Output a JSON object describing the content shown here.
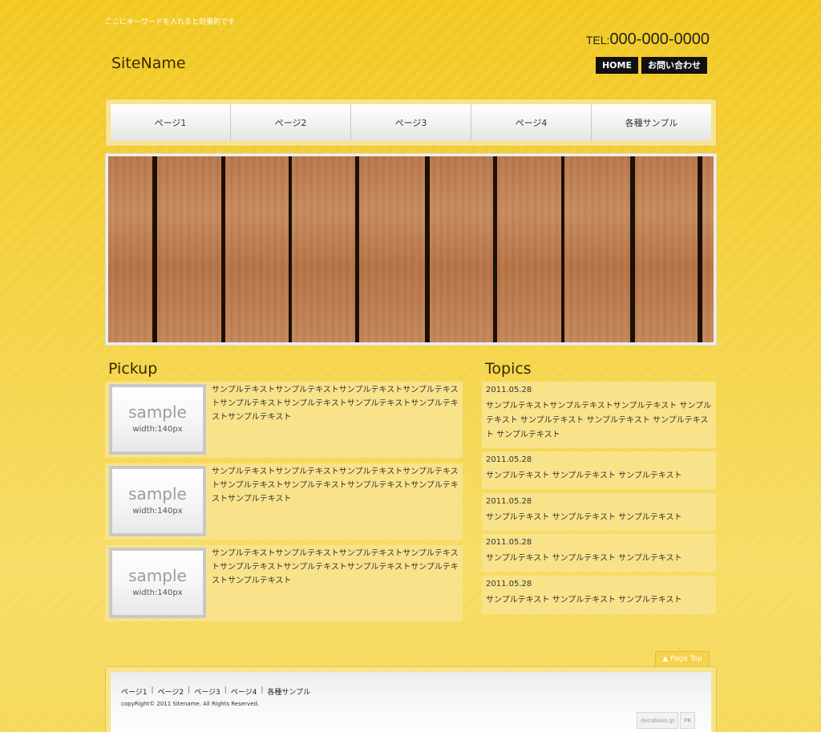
{
  "header": {
    "keyword": "ここにキーワードを入れると効果的です",
    "site_name": "SiteName",
    "tel_label": "TEL:",
    "tel_number": "000-000-0000",
    "buttons": [
      {
        "label": "HOME"
      },
      {
        "label": "お問い合わせ"
      }
    ]
  },
  "nav": {
    "items": [
      {
        "label": "ページ1"
      },
      {
        "label": "ページ2"
      },
      {
        "label": "ページ3"
      },
      {
        "label": "ページ4"
      },
      {
        "label": "各種サンプル"
      }
    ]
  },
  "pickup": {
    "title": "Pickup",
    "items": [
      {
        "img_big": "sample",
        "img_small": "width:140px",
        "text": "サンプルテキストサンプルテキストサンプルテキストサンプルテキストサンプルテキストサンプルテキストサンプルテキストサンプルテキストサンプルテキスト"
      },
      {
        "img_big": "sample",
        "img_small": "width:140px",
        "text": "サンプルテキストサンプルテキストサンプルテキストサンプルテキストサンプルテキストサンプルテキストサンプルテキストサンプルテキストサンプルテキスト"
      },
      {
        "img_big": "sample",
        "img_small": "width:140px",
        "text": "サンプルテキストサンプルテキストサンプルテキストサンプルテキストサンプルテキストサンプルテキストサンプルテキストサンプルテキストサンプルテキスト"
      }
    ]
  },
  "topics": {
    "title": "Topics",
    "items": [
      {
        "date": "2011.05.28",
        "text": "サンプルテキストサンプルテキストサンプルテキスト サンプルテキスト サンプルテキスト サンプルテキスト サンプルテキスト サンプルテキスト"
      },
      {
        "date": "2011.05.28",
        "text": "サンプルテキスト サンプルテキスト サンプルテキスト"
      },
      {
        "date": "2011.05.28",
        "text": "サンプルテキスト サンプルテキスト サンプルテキスト"
      },
      {
        "date": "2011.05.28",
        "text": "サンプルテキスト サンプルテキスト サンプルテキスト"
      },
      {
        "date": "2011.05.28",
        "text": "サンプルテキスト サンプルテキスト サンプルテキスト"
      }
    ]
  },
  "footer": {
    "page_top": "▲ Page Top",
    "nav": [
      {
        "label": "ページ1"
      },
      {
        "label": "ページ2"
      },
      {
        "label": "ページ3"
      },
      {
        "label": "ページ4"
      },
      {
        "label": "各種サンプル"
      }
    ],
    "separator": "|",
    "copyright": "copyRight© 2011 Sitename. All Rights Reserved.",
    "badge_site": "decoboko.jp",
    "badge_pr": "PR"
  }
}
